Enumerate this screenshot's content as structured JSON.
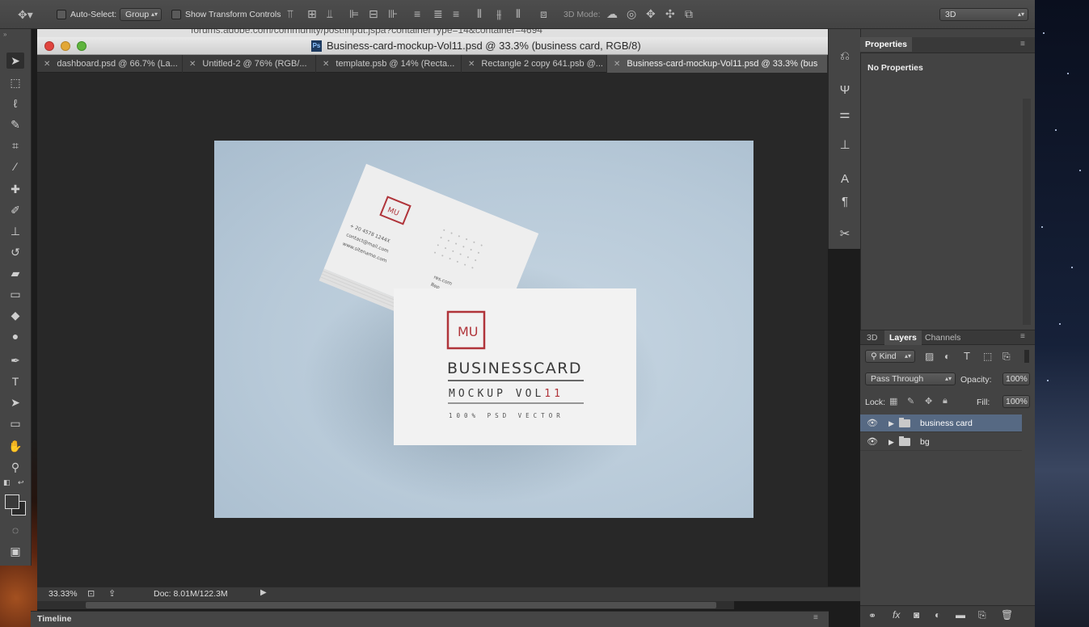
{
  "options_bar": {
    "auto_select_label": "Auto-Select:",
    "auto_select_value": "Group",
    "show_transform_label": "Show Transform Controls",
    "mode_3d_label": "3D Mode:",
    "workspace_value": "3D"
  },
  "browser_url": "forums.adobe.com/community/post!input.jspa?containerType=14&container=4694",
  "document": {
    "title": "Business-card-mockup-Vol11.psd @ 33.3% (business card, RGB/8)",
    "tabs": [
      {
        "label": "dashboard.psd @ 66.7% (La..."
      },
      {
        "label": "Untitled-2 @ 76% (RGB/..."
      },
      {
        "label": "template.psb @ 14% (Recta..."
      },
      {
        "label": "Rectangle 2 copy 641.psb @..."
      },
      {
        "label": "Business-card-mockup-Vol11.psd @ 33.3% (bus"
      }
    ]
  },
  "artwork": {
    "logo": "MU",
    "heading": "BUSINESSCARD",
    "subheading_main": "MOCKUP VOL",
    "subheading_num": "11",
    "tagline": "100% PSD VECTOR",
    "back_phone": "+ 20 4578 1244X",
    "back_email": "contact@mail.com",
    "back_site": "www.sitename.com",
    "back_lines": [
      "res.com",
      "Rep"
    ]
  },
  "status": {
    "zoom": "33.33%",
    "doc_size": "Doc: 8.01M/122.3M"
  },
  "timeline_label": "Timeline",
  "properties": {
    "title": "Properties",
    "empty_text": "No Properties"
  },
  "layers_panel": {
    "tabs": [
      "3D",
      "Layers",
      "Channels"
    ],
    "filter_kind": "Kind",
    "blend_mode": "Pass Through",
    "opacity_label": "Opacity:",
    "opacity_value": "100%",
    "lock_label": "Lock:",
    "fill_label": "Fill:",
    "fill_value": "100%",
    "layers": [
      {
        "name": "business card",
        "selected": true
      },
      {
        "name": "bg",
        "selected": false
      }
    ]
  },
  "colors": {
    "brand_red": "#b0343a",
    "selection_blue": "#566983"
  }
}
